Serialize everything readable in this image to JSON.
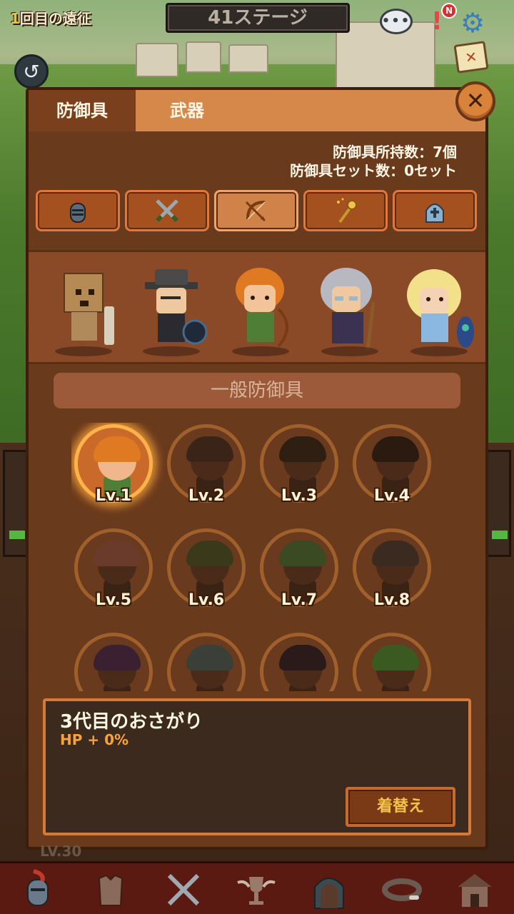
{
  "hud": {
    "expedition_number": "1",
    "expedition_label": "回目の遠征",
    "stage": "41ステージ",
    "notice_badge": "N"
  },
  "tabs": [
    {
      "label": "防御具",
      "active": true
    },
    {
      "label": "武器",
      "active": false
    }
  ],
  "counts": {
    "owned_label": "防御具所持数：",
    "owned_value": "7個",
    "sets_label": "防御具セット数：",
    "sets_value": "0セット"
  },
  "categories": [
    {
      "icon": "knight-helmet-icon",
      "active": false
    },
    {
      "icon": "crossed-swords-icon",
      "active": false
    },
    {
      "icon": "bow-arrow-icon",
      "active": true
    },
    {
      "icon": "magic-staff-icon",
      "active": false
    },
    {
      "icon": "priest-hat-icon",
      "active": false
    }
  ],
  "heroes": [
    {
      "icon": "box-head-hero"
    },
    {
      "icon": "fedora-chef-hero"
    },
    {
      "icon": "archer-girl-hero"
    },
    {
      "icon": "wizard-elder-hero"
    },
    {
      "icon": "princess-hero"
    }
  ],
  "section_title": "一般防御具",
  "skins": [
    {
      "level": "Lv.1",
      "selected": true,
      "hair": "#e07a22"
    },
    {
      "level": "Lv.2",
      "selected": false,
      "hair": "#3a2418"
    },
    {
      "level": "Lv.3",
      "selected": false,
      "hair": "#2f1e12"
    },
    {
      "level": "Lv.4",
      "selected": false,
      "hair": "#2a1a10"
    },
    {
      "level": "Lv.5",
      "selected": false,
      "hair": "#6a3a2a"
    },
    {
      "level": "Lv.6",
      "selected": false,
      "hair": "#3a3a1a"
    },
    {
      "level": "Lv.7",
      "selected": false,
      "hair": "#3a4a22"
    },
    {
      "level": "Lv.8",
      "selected": false,
      "hair": "#3a2a20"
    },
    {
      "level": "",
      "selected": false,
      "hair": "#3a2030"
    },
    {
      "level": "",
      "selected": false,
      "hair": "#3a4038"
    },
    {
      "level": "",
      "selected": false,
      "hair": "#2a1a1a"
    },
    {
      "level": "",
      "selected": false,
      "hair": "#3a5a22"
    }
  ],
  "info": {
    "name": "3代目のおさがり",
    "stat": "HP + 0%",
    "equip_label": "着替え"
  },
  "under_level": "LV.30",
  "nav": [
    {
      "icon": "knight-helmet-nav-icon"
    },
    {
      "icon": "armor-nav-icon"
    },
    {
      "icon": "swords-nav-icon"
    },
    {
      "icon": "trophy-nav-icon"
    },
    {
      "icon": "dungeon-gate-nav-icon"
    },
    {
      "icon": "collar-nav-icon"
    },
    {
      "icon": "shop-nav-icon"
    }
  ]
}
